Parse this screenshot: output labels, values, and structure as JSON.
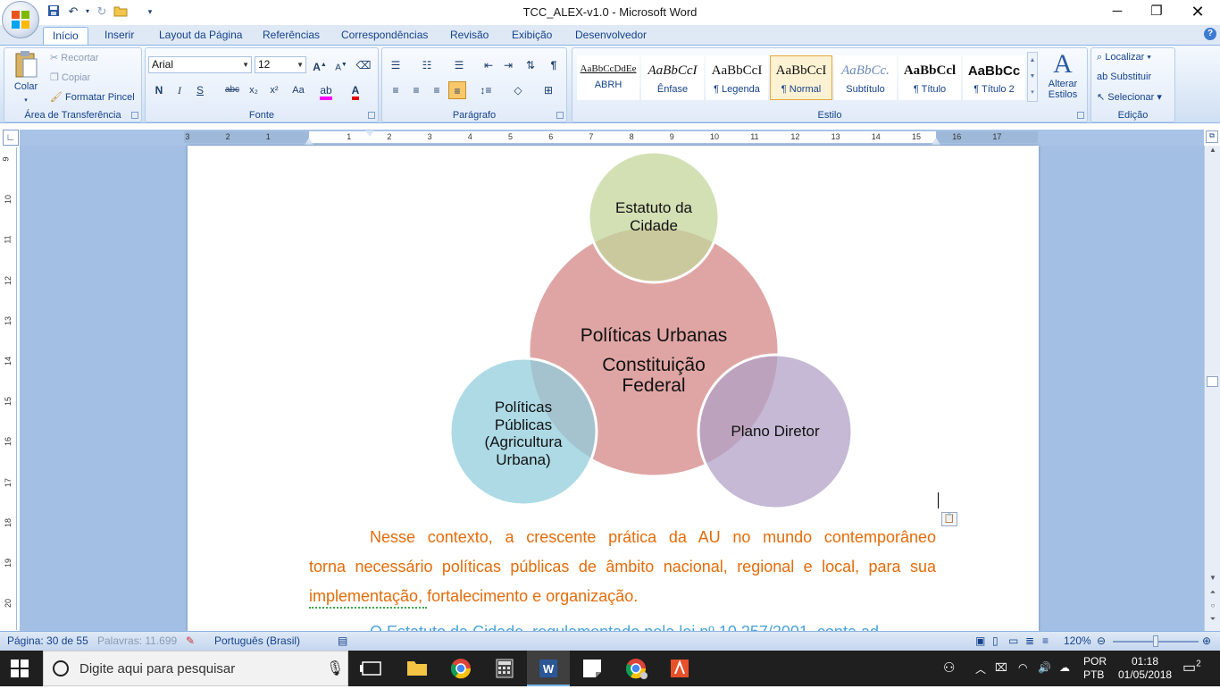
{
  "window": {
    "title": "TCC_ALEX-v1.0 - Microsoft Word"
  },
  "tabs": [
    "Início",
    "Inserir",
    "Layout da Página",
    "Referências",
    "Correspondências",
    "Revisão",
    "Exibição",
    "Desenvolvedor"
  ],
  "clipboard": {
    "paste_label": "Colar",
    "cut_label": "Recortar",
    "copy_label": "Copiar",
    "format_painter_label": "Formatar Pincel",
    "group_label": "Área de Transferência"
  },
  "font": {
    "name": "Arial",
    "size": "12",
    "group_label": "Fonte",
    "bold": "N",
    "italic": "I",
    "underline": "S",
    "strike": "abc",
    "subscript": "x₂",
    "superscript": "x²",
    "case": "Aa",
    "grow": "A",
    "shrink": "A"
  },
  "paragraph": {
    "group_label": "Parágrafo"
  },
  "styles": {
    "group_label": "Estilo",
    "items": [
      {
        "sample": "AaBbCcDdEe",
        "name": "ABRH"
      },
      {
        "sample": "AaBbCcI",
        "name": "Ênfase"
      },
      {
        "sample": "AaBbCcI",
        "name": "¶ Legenda"
      },
      {
        "sample": "AaBbCcI",
        "name": "¶ Normal"
      },
      {
        "sample": "AaBbCc.",
        "name": "Subtítulo"
      },
      {
        "sample": "AaBbCcl",
        "name": "¶ Título"
      },
      {
        "sample": "AaBbCc",
        "name": "¶ Título 2"
      }
    ],
    "change_styles_label_1": "Alterar",
    "change_styles_label_2": "Estilos"
  },
  "editing": {
    "group_label": "Edição",
    "find_label": "Localizar",
    "replace_label": "Substituir",
    "select_label": "Selecionar"
  },
  "ruler": {
    "h_numbers": [
      "3",
      "2",
      "1",
      "1",
      "2",
      "3",
      "4",
      "5",
      "6",
      "7",
      "8",
      "9",
      "10",
      "11",
      "12",
      "13",
      "14",
      "15",
      "16",
      "17"
    ],
    "v_numbers": [
      "9",
      "10",
      "11",
      "12",
      "13",
      "14",
      "15",
      "16",
      "17",
      "18",
      "19",
      "20"
    ]
  },
  "diagram": {
    "top_circle": [
      "Estatuto da",
      "Cidade"
    ],
    "center_circle": [
      "Políticas Urbanas",
      "Constituição",
      "Federal"
    ],
    "left_circle": [
      "Políticas",
      "Públicas",
      "(Agricultura",
      "Urbana)"
    ],
    "right_circle": [
      "Plano Diretor"
    ],
    "colors": {
      "top": "#c3d69b",
      "center": "#d99594",
      "left": "#92cddc",
      "right": "#b2a1c7"
    }
  },
  "document": {
    "paragraph": [
      "Nesse contexto, a crescente prática da AU no mundo contemporâneo",
      "torna necessário políticas públicas de âmbito nacional, regional e local, para sua",
      "implementação, fortalecimento e organização."
    ],
    "next_line_partial": "O Estatuto da Cidade, regulamentado pela lei nº 10.257/2001, conta ad"
  },
  "status": {
    "page": "Página: 30 de 55",
    "words": "Palavras: 11.699",
    "language": "Português (Brasil)",
    "zoom": "120%"
  },
  "taskbar": {
    "search_placeholder": "Digite aqui para pesquisar",
    "lang_1": "POR",
    "lang_2": "PTB",
    "time": "01:18",
    "date": "01/05/2018",
    "notifications": "2"
  }
}
